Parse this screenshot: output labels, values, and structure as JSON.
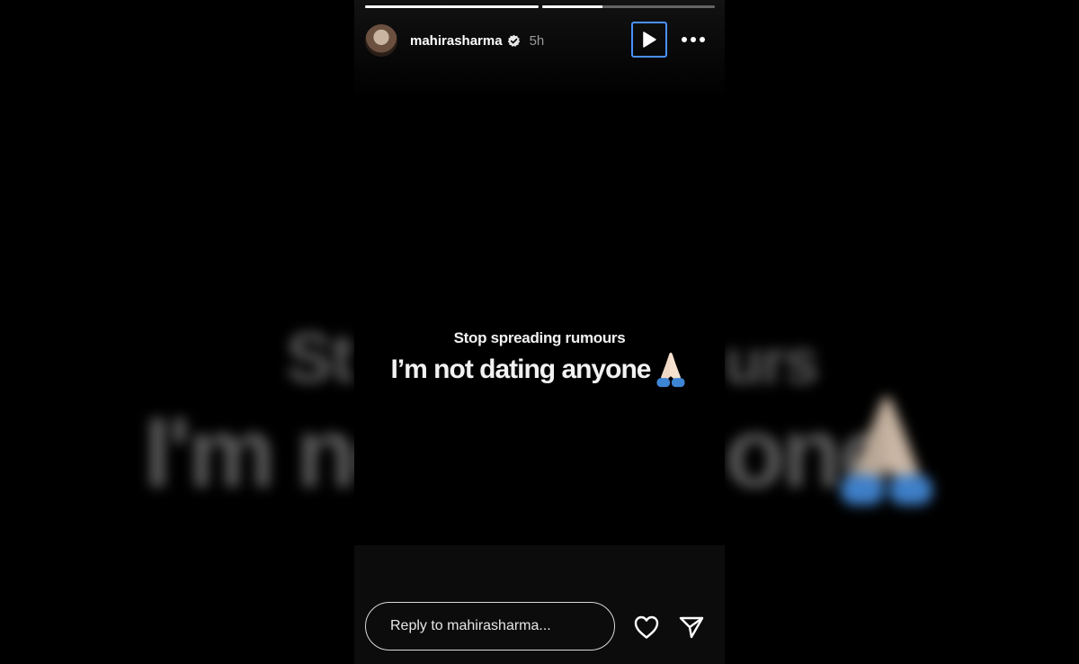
{
  "story": {
    "username": "mahirasharma",
    "verified": true,
    "time_ago": "5h",
    "progress": [
      1.0,
      0.35
    ],
    "text_line1": "Stop spreading rumours",
    "text_line2": "I’m not dating anyone",
    "emoji": "folded-hands"
  },
  "background": {
    "line1a": "St",
    "line1b": "urs",
    "line2a": "I'm not",
    "line2b": "one"
  },
  "reply": {
    "placeholder": "Reply to mahirasharma..."
  },
  "icons": {
    "play": "play-icon",
    "more": "more-options-icon",
    "like": "heart-icon",
    "share": "send-icon",
    "verified": "verified-badge-icon"
  },
  "colors": {
    "focus_outline": "#4a90ff",
    "text": "#f2f2f2",
    "meta_text": "#9a9a9a"
  }
}
